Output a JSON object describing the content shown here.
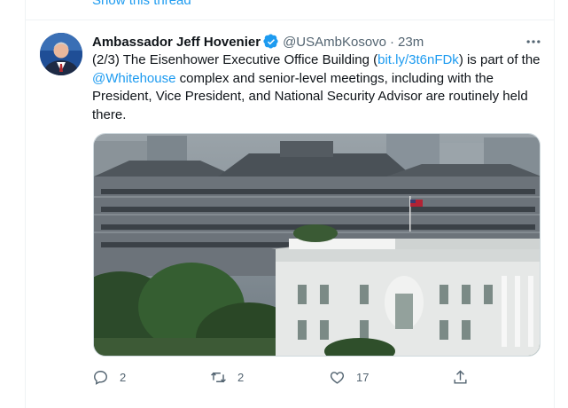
{
  "thread": {
    "show_thread_label": "Show this thread"
  },
  "tweet": {
    "display_name": "Ambassador Jeff Hovenier",
    "handle": "@USAmbKosovo",
    "separator": "·",
    "time": "23m",
    "text_parts": {
      "p1": "(2/3) The Eisenhower Executive Office Building (",
      "link1": "bit.ly/3t6nFDk",
      "p2": ") is part of the ",
      "mention": "@Whitehouse",
      "p3": " complex and senior-level meetings, including with the President, Vice President, and National Security Advisor are routinely held there."
    },
    "media_description_icon": "photo",
    "actions": {
      "replies": "2",
      "retweets": "2",
      "likes": "17"
    },
    "icons": {
      "verified": "verified-badge-icon",
      "more": "more-icon",
      "reply": "reply-icon",
      "retweet": "retweet-icon",
      "like": "heart-icon",
      "share": "share-icon"
    }
  },
  "colors": {
    "accent": "#1d9bf0",
    "secondary_text": "#536471",
    "border": "#eff3f4"
  }
}
